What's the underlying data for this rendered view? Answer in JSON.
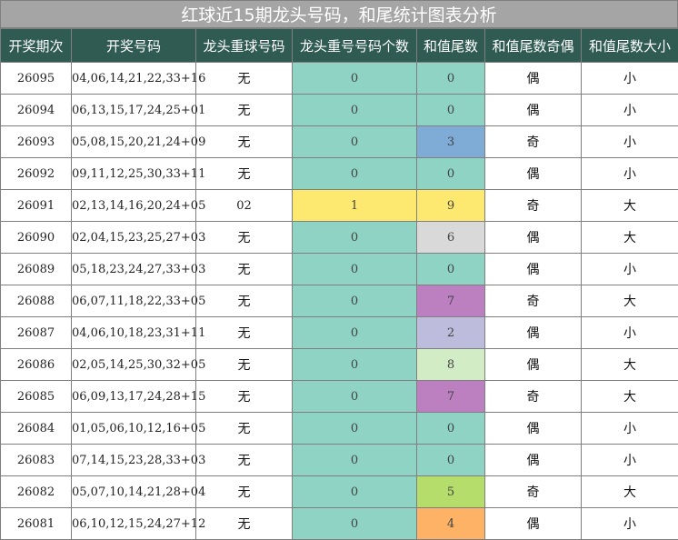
{
  "title": "红球近15期龙头号码，和尾统计图表分析",
  "headers": [
    "开奖期次",
    "开奖号码",
    "龙头重球号码",
    "龙头重号号码个数",
    "和值尾数",
    "和值尾数奇偶",
    "和值尾数大小"
  ],
  "colors": {
    "header_bg": "#2f5b52",
    "title_bg": "#a5a5a5",
    "count_default": "#8ed3c3",
    "count_highlight": "#fde870"
  },
  "rows": [
    {
      "period": "26095",
      "numbers": "04,06,14,21,22,33+16",
      "repeat": "无",
      "count": "0",
      "sum_tail": "0",
      "sum_color": "#8ed3c3",
      "parity": "偶",
      "size": "小"
    },
    {
      "period": "26094",
      "numbers": "06,13,15,17,24,25+01",
      "repeat": "无",
      "count": "0",
      "sum_tail": "0",
      "sum_color": "#8ed3c3",
      "parity": "偶",
      "size": "小"
    },
    {
      "period": "26093",
      "numbers": "05,08,15,20,21,24+09",
      "repeat": "无",
      "count": "0",
      "sum_tail": "3",
      "sum_color": "#7facd6",
      "parity": "奇",
      "size": "小"
    },
    {
      "period": "26092",
      "numbers": "09,11,12,25,30,33+11",
      "repeat": "无",
      "count": "0",
      "sum_tail": "0",
      "sum_color": "#8ed3c3",
      "parity": "偶",
      "size": "小"
    },
    {
      "period": "26091",
      "numbers": "02,13,14,16,20,24+05",
      "repeat": "02",
      "count": "1",
      "sum_tail": "9",
      "sum_color": "#fde870",
      "parity": "奇",
      "size": "大"
    },
    {
      "period": "26090",
      "numbers": "02,04,15,23,25,27+03",
      "repeat": "无",
      "count": "0",
      "sum_tail": "6",
      "sum_color": "#d9d9d9",
      "parity": "偶",
      "size": "大"
    },
    {
      "period": "26089",
      "numbers": "05,18,23,24,27,33+03",
      "repeat": "无",
      "count": "0",
      "sum_tail": "0",
      "sum_color": "#8ed3c3",
      "parity": "偶",
      "size": "小"
    },
    {
      "period": "26088",
      "numbers": "06,07,11,18,22,33+05",
      "repeat": "无",
      "count": "0",
      "sum_tail": "7",
      "sum_color": "#bc7fc0",
      "parity": "奇",
      "size": "大"
    },
    {
      "period": "26087",
      "numbers": "04,06,10,18,23,31+11",
      "repeat": "无",
      "count": "0",
      "sum_tail": "2",
      "sum_color": "#bdbcdc",
      "parity": "偶",
      "size": "小"
    },
    {
      "period": "26086",
      "numbers": "02,05,14,25,30,32+05",
      "repeat": "无",
      "count": "0",
      "sum_tail": "8",
      "sum_color": "#d2ecc6",
      "parity": "偶",
      "size": "大"
    },
    {
      "period": "26085",
      "numbers": "06,09,13,17,24,28+15",
      "repeat": "无",
      "count": "0",
      "sum_tail": "7",
      "sum_color": "#bc7fc0",
      "parity": "奇",
      "size": "大"
    },
    {
      "period": "26084",
      "numbers": "01,05,06,10,12,16+05",
      "repeat": "无",
      "count": "0",
      "sum_tail": "0",
      "sum_color": "#8ed3c3",
      "parity": "偶",
      "size": "小"
    },
    {
      "period": "26083",
      "numbers": "07,14,15,23,28,33+03",
      "repeat": "无",
      "count": "0",
      "sum_tail": "0",
      "sum_color": "#8ed3c3",
      "parity": "偶",
      "size": "小"
    },
    {
      "period": "26082",
      "numbers": "05,07,10,14,21,28+04",
      "repeat": "无",
      "count": "0",
      "sum_tail": "5",
      "sum_color": "#b4dd6c",
      "parity": "奇",
      "size": "大"
    },
    {
      "period": "26081",
      "numbers": "06,10,12,15,24,27+12",
      "repeat": "无",
      "count": "0",
      "sum_tail": "4",
      "sum_color": "#fdb266",
      "parity": "偶",
      "size": "小"
    }
  ]
}
